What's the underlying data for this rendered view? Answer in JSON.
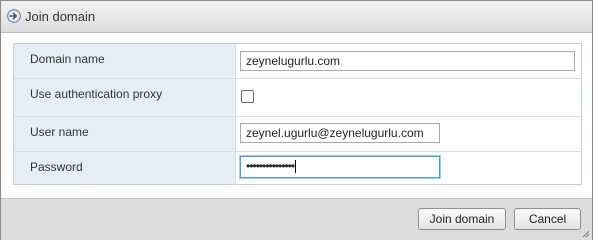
{
  "dialog": {
    "title": "Join domain",
    "title_icon": "join-domain-arrow-icon"
  },
  "form": {
    "domain_name": {
      "label": "Domain name",
      "value": "zeynelugurlu.com"
    },
    "auth_proxy": {
      "label": "Use authentication proxy",
      "checked": false
    },
    "user_name": {
      "label": "User name",
      "value": "zeynel.ugurlu@zeynelugurlu.com"
    },
    "password": {
      "label": "Password",
      "masked_value": "•••••••••••••••"
    }
  },
  "buttons": {
    "join": "Join domain",
    "cancel": "Cancel"
  },
  "colors": {
    "label_background": "#e5eef6",
    "focus_border": "#4da0d3",
    "footer_background": "#dcdcdc"
  }
}
